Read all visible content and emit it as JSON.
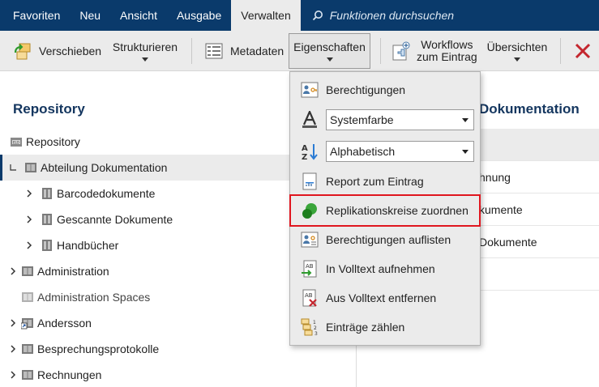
{
  "menubar": {
    "items": [
      "Favoriten",
      "Neu",
      "Ansicht",
      "Ausgabe",
      "Verwalten"
    ],
    "active": "Verwalten",
    "search_placeholder": "Funktionen durchsuchen"
  },
  "ribbon": {
    "move": "Verschieben",
    "structure": "Strukturieren",
    "metadata": "Metadaten",
    "properties": "Eigenschaften",
    "workflows_line1": "Workflows",
    "workflows_line2": "zum Eintrag",
    "overviews": "Übersichten"
  },
  "left_panel": {
    "title": "Repository",
    "tree": [
      {
        "label": "Repository",
        "level": 0,
        "expand": "none",
        "icon": "repository-icon"
      },
      {
        "label": "Abteilung Dokumentation",
        "level": 0,
        "expand": "expanded",
        "icon": "cabinet-icon",
        "selected": true
      },
      {
        "label": "Barcodedokumente",
        "level": 1,
        "expand": "collapsed",
        "icon": "folder-icon"
      },
      {
        "label": "Gescannte Dokumente",
        "level": 1,
        "expand": "collapsed",
        "icon": "folder-icon"
      },
      {
        "label": "Handbücher",
        "level": 1,
        "expand": "collapsed",
        "icon": "folder-icon"
      },
      {
        "label": "Administration",
        "level": 0,
        "expand": "collapsed",
        "icon": "cabinet-icon"
      },
      {
        "label": "Administration Spaces",
        "level": 0,
        "expand": "none",
        "icon": "cabinet-grey-icon"
      },
      {
        "label": "Andersson",
        "level": 0,
        "expand": "collapsed",
        "icon": "cabinet-link-icon"
      },
      {
        "label": "Besprechungsprotokolle",
        "level": 0,
        "expand": "collapsed",
        "icon": "cabinet-icon"
      },
      {
        "label": "Rechnungen",
        "level": 0,
        "expand": "collapsed",
        "icon": "cabinet-icon"
      }
    ]
  },
  "right_panel": {
    "title": "Dokumentation",
    "rows": [
      "",
      "hnung",
      "kumente",
      "Dokumente",
      ""
    ]
  },
  "dropdown": {
    "items": [
      {
        "label": "Berechtigungen",
        "icon": "permissions-icon"
      },
      {
        "select": "Systemfarbe",
        "icon": "font-color-icon"
      },
      {
        "select": "Alphabetisch",
        "icon": "sort-icon"
      },
      {
        "label": "Report zum Eintrag",
        "icon": "report-icon"
      },
      {
        "label": "Replikationskreise zuordnen",
        "icon": "replication-icon",
        "highlighted": true
      },
      {
        "label": "Berechtigungen auflisten",
        "icon": "list-permissions-icon"
      },
      {
        "label": "In Volltext aufnehmen",
        "icon": "fulltext-add-icon"
      },
      {
        "label": "Aus Volltext entfernen",
        "icon": "fulltext-remove-icon"
      },
      {
        "label": "Einträge zählen",
        "icon": "count-icon"
      }
    ]
  },
  "colors": {
    "menubar": "#0a3a6b",
    "ribbon": "#ebebeb",
    "title": "#14365f",
    "highlight_border": "#e0161f",
    "replication_green": "#2d9b2d"
  }
}
